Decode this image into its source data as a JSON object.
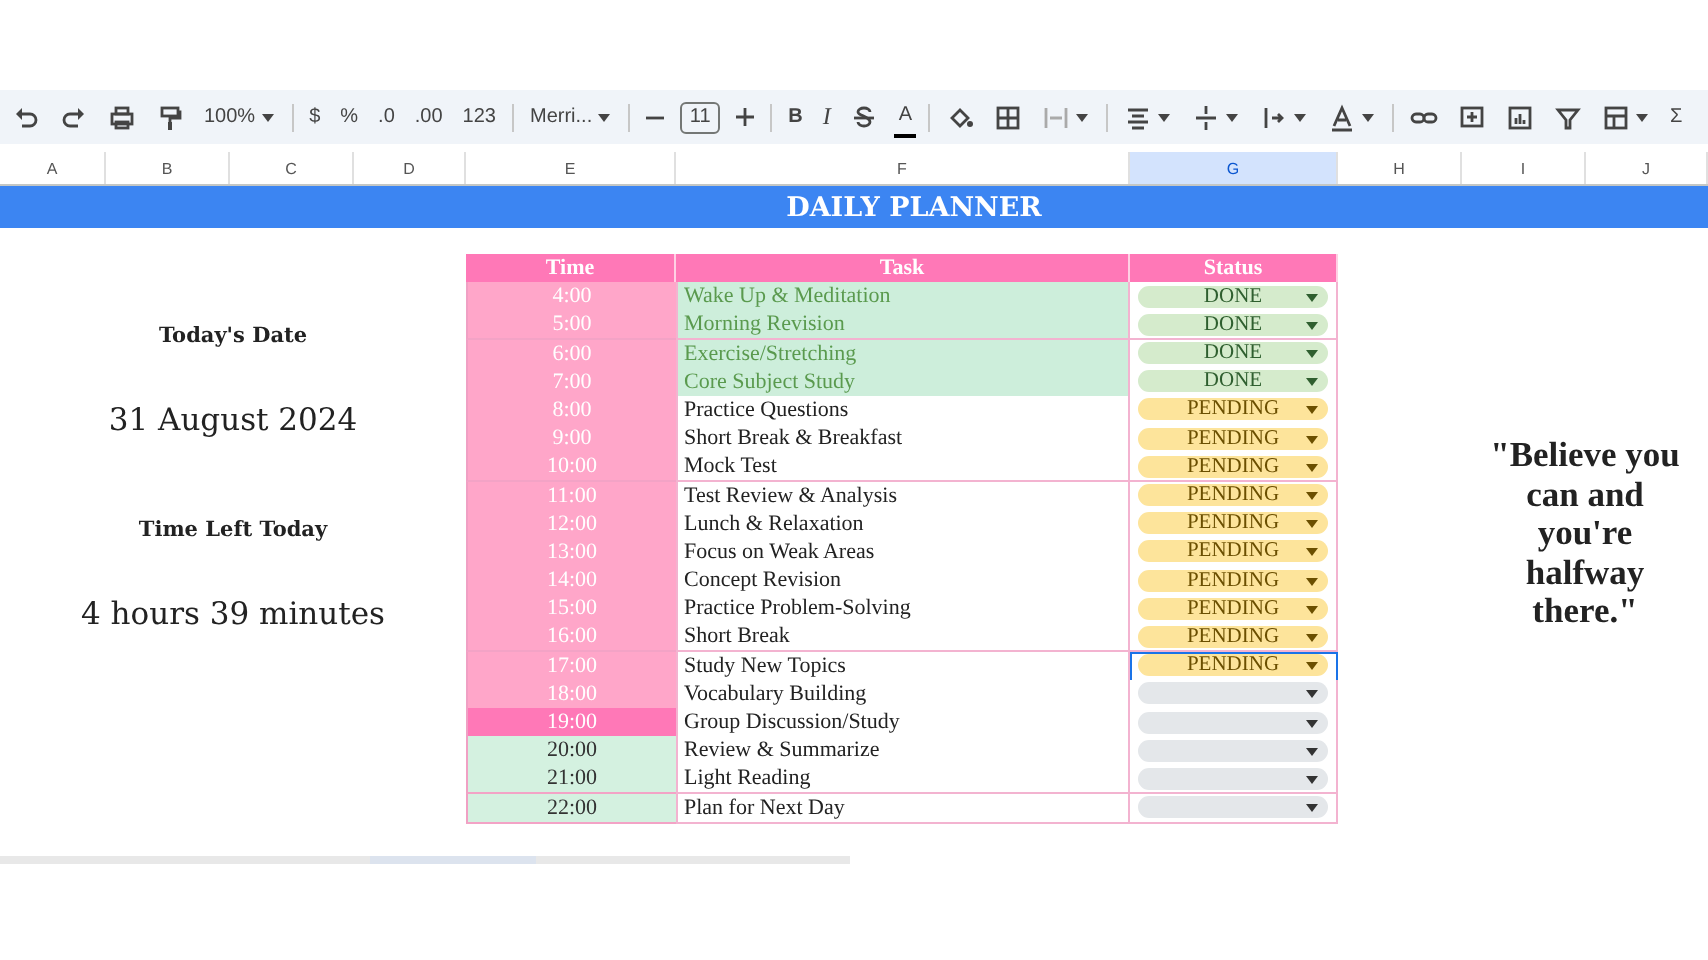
{
  "toolbar": {
    "zoom": "100%",
    "currency": "$",
    "percent": "%",
    "decrease_decimals": ".0",
    "increase_decimals": ".00",
    "number_format": "123",
    "font": "Merri...",
    "font_size": "11",
    "bold": "B",
    "italic": "I",
    "text_color": "A",
    "sum": "Σ"
  },
  "columns": [
    {
      "label": "A",
      "selected": false
    },
    {
      "label": "B",
      "selected": false
    },
    {
      "label": "C",
      "selected": false
    },
    {
      "label": "D",
      "selected": false
    },
    {
      "label": "E",
      "selected": false
    },
    {
      "label": "F",
      "selected": false
    },
    {
      "label": "G",
      "selected": true
    },
    {
      "label": "H",
      "selected": false
    },
    {
      "label": "I",
      "selected": false
    },
    {
      "label": "J",
      "selected": false
    }
  ],
  "title": "DAILY PLANNER",
  "info": [
    {
      "label": "Today's Date",
      "value": "31 August 2024"
    },
    {
      "label": "Time Left Today",
      "value": "4 hours 39 minutes"
    }
  ],
  "table": {
    "headers": [
      "Time",
      "Task",
      "Status"
    ],
    "rows": [
      {
        "time": "4:00",
        "color": "#ffa6c9",
        "task": "Wake Up & Meditation",
        "done": true,
        "status": {
          "kind": "done",
          "label": "DONE"
        },
        "selected": false
      },
      {
        "time": "5:00",
        "color": "#ffa6c9",
        "task": "Morning Revision",
        "done": true,
        "status": {
          "kind": "done",
          "label": "DONE"
        },
        "selected": false
      },
      {
        "time": "6:00",
        "color": "#ffa6c9",
        "task": "Exercise/Stretching",
        "done": true,
        "status": {
          "kind": "done",
          "label": "DONE"
        },
        "selected": false
      },
      {
        "time": "7:00",
        "color": "#ffa6c9",
        "task": "Core Subject Study",
        "done": true,
        "status": {
          "kind": "done",
          "label": "DONE"
        },
        "selected": false
      },
      {
        "time": "8:00",
        "color": "#ffa6c9",
        "task": "Practice Questions",
        "done": false,
        "status": {
          "kind": "pending",
          "label": "PENDING"
        },
        "selected": false
      },
      {
        "time": "9:00",
        "color": "#ffa6c9",
        "task": "Short Break & Breakfast",
        "done": false,
        "status": {
          "kind": "pending",
          "label": "PENDING"
        },
        "selected": false
      },
      {
        "time": "10:00",
        "color": "#ffa6c9",
        "task": "Mock Test",
        "done": false,
        "status": {
          "kind": "pending",
          "label": "PENDING"
        },
        "selected": false
      },
      {
        "time": "11:00",
        "color": "#ffa6c9",
        "task": "Test Review & Analysis",
        "done": false,
        "status": {
          "kind": "pending",
          "label": "PENDING"
        },
        "selected": false
      },
      {
        "time": "12:00",
        "color": "#ffa6c9",
        "task": "Lunch & Relaxation",
        "done": false,
        "status": {
          "kind": "pending",
          "label": "PENDING"
        },
        "selected": false
      },
      {
        "time": "13:00",
        "color": "#ffa6c9",
        "task": "Focus on Weak Areas",
        "done": false,
        "status": {
          "kind": "pending",
          "label": "PENDING"
        },
        "selected": false
      },
      {
        "time": "14:00",
        "color": "#ffa6c9",
        "task": "Concept Revision",
        "done": false,
        "status": {
          "kind": "pending",
          "label": "PENDING"
        },
        "selected": false
      },
      {
        "time": "15:00",
        "color": "#ffa6c9",
        "task": "Practice Problem-Solving",
        "done": false,
        "status": {
          "kind": "pending",
          "label": "PENDING"
        },
        "selected": false
      },
      {
        "time": "16:00",
        "color": "#ffa6c9",
        "task": "Short Break",
        "done": false,
        "status": {
          "kind": "pending",
          "label": "PENDING"
        },
        "selected": false
      },
      {
        "time": "17:00",
        "color": "#ffa6c9",
        "task": "Study New Topics",
        "done": false,
        "status": {
          "kind": "pending",
          "label": "PENDING"
        },
        "selected": true
      },
      {
        "time": "18:00",
        "color": "#ffa6c9",
        "task": "Vocabulary Building",
        "done": false,
        "status": {
          "kind": "empty"
        },
        "selected": false
      },
      {
        "time": "19:00",
        "color": "#ff78b7",
        "task": "Group Discussion/Study",
        "done": false,
        "status": {
          "kind": "empty"
        },
        "selected": false
      },
      {
        "time": "20:00",
        "color": "#d4f1e0",
        "task": "Review & Summarize",
        "done": false,
        "status": {
          "kind": "empty"
        },
        "selected": false
      },
      {
        "time": "21:00",
        "color": "#d4f1e0",
        "task": "Light Reading",
        "done": false,
        "status": {
          "kind": "empty"
        },
        "selected": false
      },
      {
        "time": "22:00",
        "color": "#d4f1e0",
        "task": "Plan for Next Day",
        "done": false,
        "status": {
          "kind": "empty"
        },
        "selected": false
      }
    ]
  },
  "quote": "\"Believe you can and you're halfway there.\""
}
